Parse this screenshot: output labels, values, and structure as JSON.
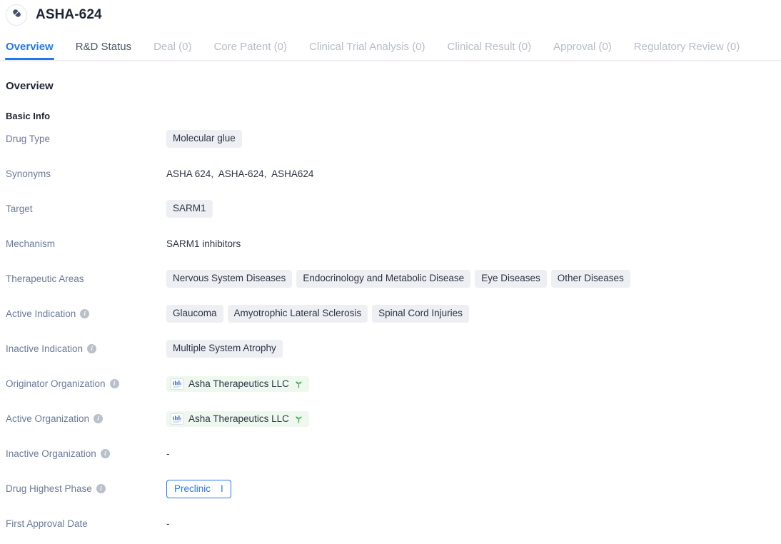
{
  "header": {
    "title": "ASHA-624",
    "avatar_icon": "pill-capsule-icon"
  },
  "tabs": [
    {
      "label": "Overview",
      "state": "active"
    },
    {
      "label": "R&D Status",
      "state": "enabled"
    },
    {
      "label": "Deal (0)",
      "state": "disabled"
    },
    {
      "label": "Core Patent (0)",
      "state": "disabled"
    },
    {
      "label": "Clinical Trial Analysis (0)",
      "state": "disabled"
    },
    {
      "label": "Clinical Result (0)",
      "state": "disabled"
    },
    {
      "label": "Approval (0)",
      "state": "disabled"
    },
    {
      "label": "Regulatory Review (0)",
      "state": "disabled"
    }
  ],
  "overview": {
    "section_title": "Overview",
    "subsection_title": "Basic Info",
    "rows": {
      "drug_type": {
        "label": "Drug Type",
        "tags": [
          "Molecular glue"
        ]
      },
      "synonyms": {
        "label": "Synonyms",
        "value": "ASHA 624,  ASHA-624,  ASHA624"
      },
      "target": {
        "label": "Target",
        "tags": [
          "SARM1"
        ]
      },
      "mechanism": {
        "label": "Mechanism",
        "value": "SARM1 inhibitors"
      },
      "therapeutic_areas": {
        "label": "Therapeutic Areas",
        "tags": [
          "Nervous System Diseases",
          "Endocrinology and Metabolic Disease",
          "Eye Diseases",
          "Other Diseases"
        ]
      },
      "active_indication": {
        "label": "Active Indication",
        "info": "i",
        "tags": [
          "Glaucoma",
          "Amyotrophic Lateral Sclerosis",
          "Spinal Cord Injuries"
        ]
      },
      "inactive_indication": {
        "label": "Inactive Indication",
        "info": "i",
        "tags": [
          "Multiple System Atrophy"
        ]
      },
      "originator_organization": {
        "label": "Originator Organization",
        "info": "i",
        "org_name": "Asha Therapeutics LLC",
        "org_logo_text": "ASHA"
      },
      "active_organization": {
        "label": "Active Organization",
        "info": "i",
        "org_name": "Asha Therapeutics LLC",
        "org_logo_text": "ASHA"
      },
      "inactive_organization": {
        "label": "Inactive Organization",
        "info": "i",
        "value": "-"
      },
      "drug_highest_phase": {
        "label": "Drug Highest Phase",
        "info": "i",
        "phase_label": "Preclinic",
        "phase_mark": "I"
      },
      "first_approval_date": {
        "label": "First Approval Date",
        "value": "-"
      }
    }
  },
  "colors": {
    "accent": "#2478ec",
    "tag_bg": "#edeff3",
    "org_chip_bg": "#eef8ee",
    "sprout_green": "#3fae4a",
    "label_gray": "#6b7a99",
    "disabled_tab": "#b6bcc8"
  }
}
